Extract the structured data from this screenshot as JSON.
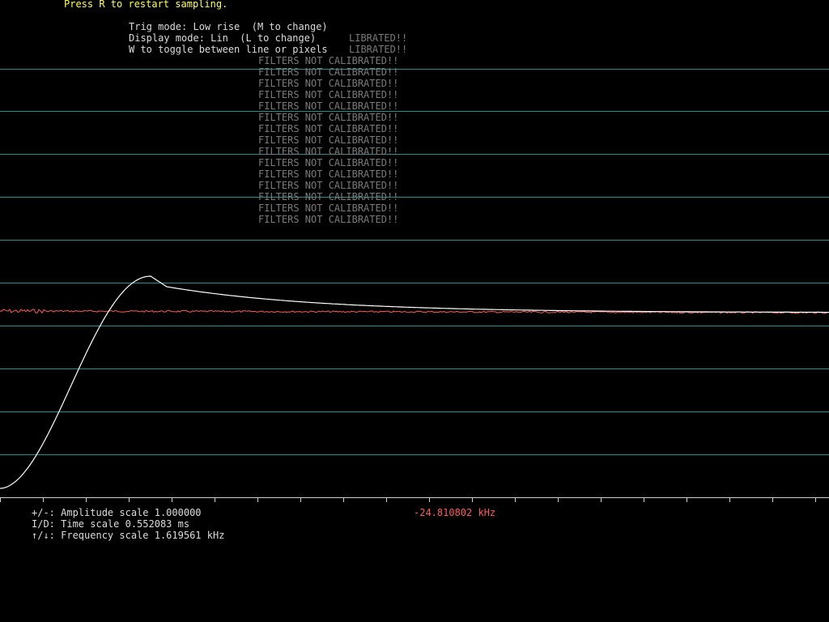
{
  "header": {
    "restart_hint": "Press R to restart sampling.",
    "trig_mode": "Trig mode: Low rise  (M to change)",
    "display_mode": "Display mode: Lin  (L to change)",
    "toggle_hint": "W to toggle between line or pixels",
    "ghost_fragment": "LIBRATED!!"
  },
  "warnings": {
    "text": "FILTERS NOT CALIBRATED!!",
    "visible_rows": 15
  },
  "footer": {
    "amplitude": "+/-: Amplitude scale 1.000000",
    "time": "I/D: Time scale 0.552083 ms",
    "frequency": "↑/↓: Frequency scale 1.619561 kHz",
    "freq_readout": "-24.810802 kHz"
  },
  "colors": {
    "grid": "#1f8f8f",
    "signal": "#ffffff",
    "spectrum": "#ff5a5a",
    "axis": "#cfcfcf",
    "header_hint": "#ffff55"
  }
}
